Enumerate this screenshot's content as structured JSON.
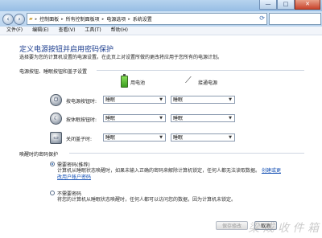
{
  "window": {
    "buttons": {
      "minimize": "—",
      "maximize": "□",
      "close": "✕"
    }
  },
  "address": {
    "crumbs": [
      "控制面板",
      "所有控制面板项",
      "电源选项",
      "系统设置"
    ],
    "search_placeholder": ""
  },
  "menu": [
    "文件(F)",
    "编辑(E)",
    "查看(V)",
    "工具(T)",
    "帮助(H)"
  ],
  "page": {
    "title": "定义电源按钮并启用密码保护",
    "desc_prefix": "选择要为您的计算机设置的电源设置。在此页上对设置所做的更改将应用于您所有的电源计划。",
    "desc_link": "",
    "section_buttons": "电源按钮、睡眠按钮和盖子设置",
    "col_battery": "用电池",
    "col_plugged": "接通电源",
    "rows": [
      {
        "icon": "power-icon",
        "label": "按电源按钮时:",
        "battery": "睡眠",
        "plugged": "睡眠"
      },
      {
        "icon": "moon-icon",
        "label": "按休眠按钮时:",
        "battery": "睡眠",
        "plugged": "睡眠"
      },
      {
        "icon": "laptop-lid-icon",
        "label": "关闭盖子时:",
        "battery": "睡眠",
        "plugged": "睡眠"
      }
    ],
    "section_password": "唤醒时的密码保护",
    "opt1_label": "需要密码(推荐)",
    "opt1_desc": "计算机从睡眠状态唤醒时，如果未输入正确的密码来解除计算机锁定，任何人都无法读取数据。",
    "opt1_link": "创建或更改用户帐户密码",
    "opt2_label": "不需要密码",
    "opt2_desc": "将您的计算机从睡眠状态唤醒时，任何人都可以访问您的数据，因为计算机未锁定。",
    "save_label": "保存修改",
    "cancel_label": "取消"
  },
  "watermark": "梁 成 收 件 箱"
}
